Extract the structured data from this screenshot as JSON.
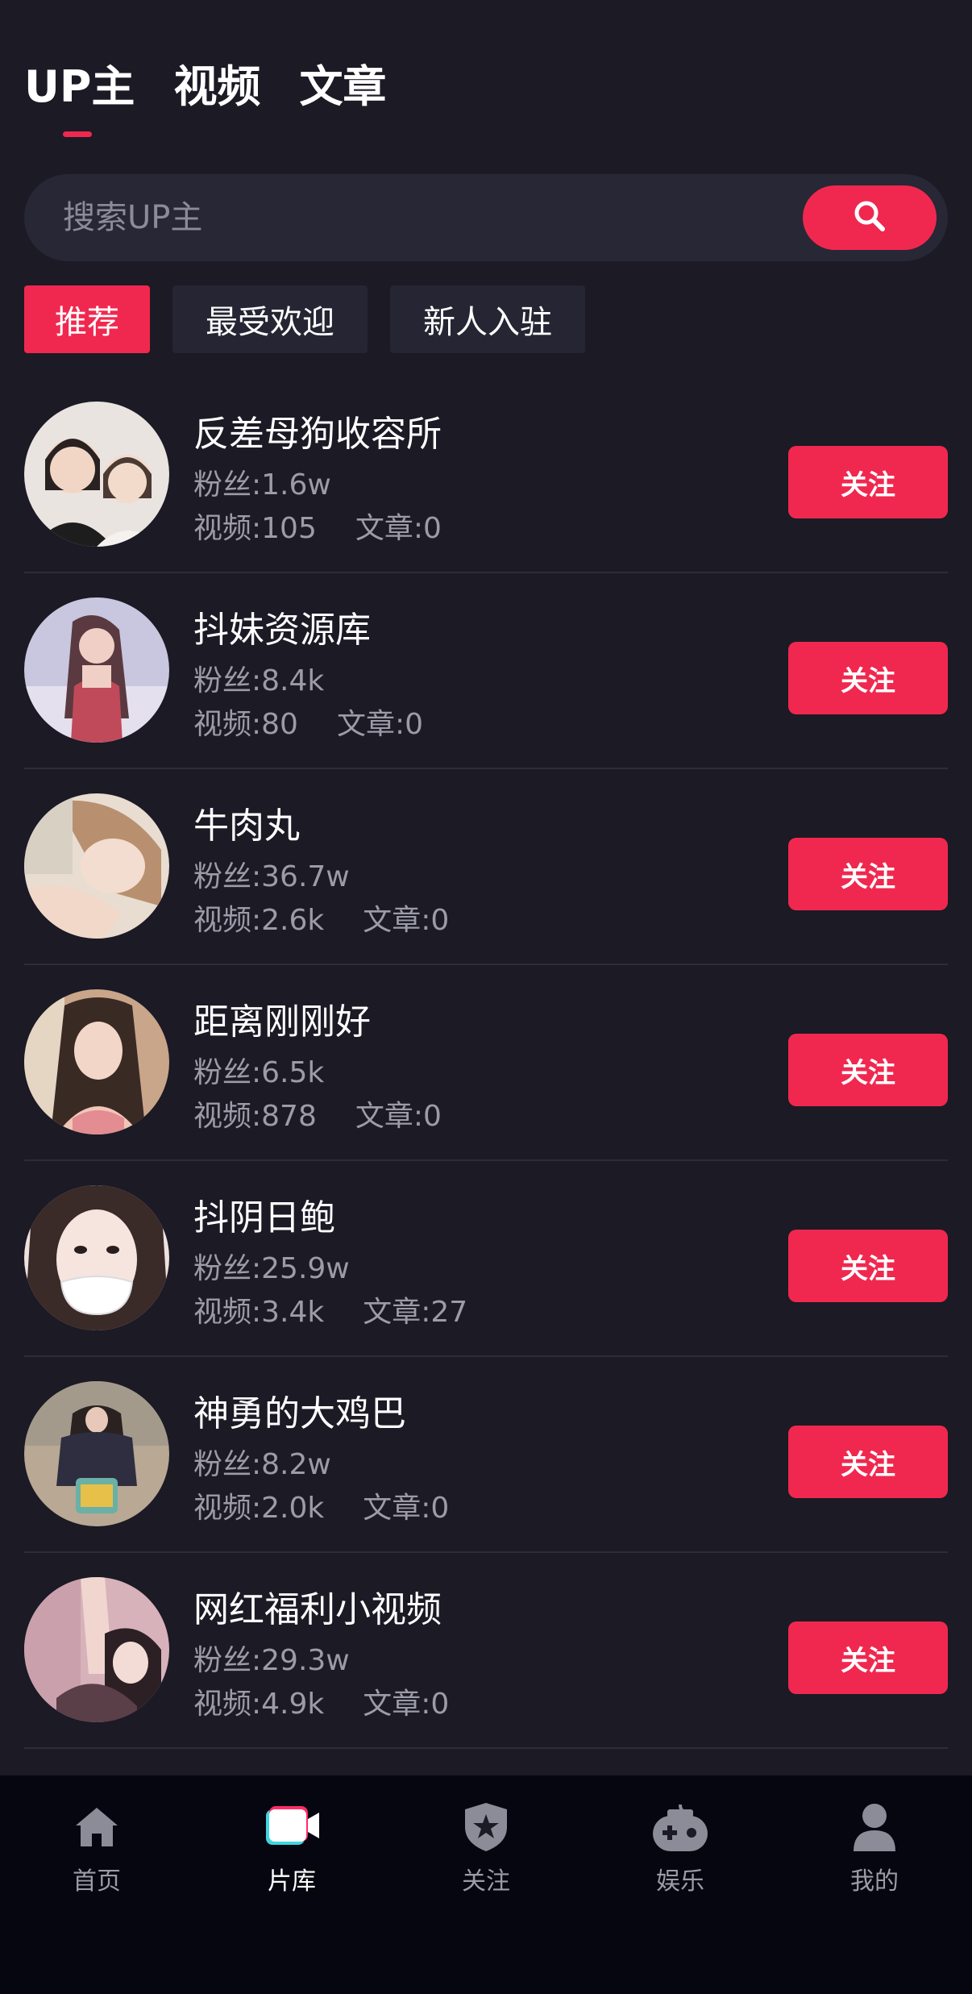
{
  "top_tabs": [
    {
      "label": "UP主",
      "active": true
    },
    {
      "label": "视频",
      "active": false
    },
    {
      "label": "文章",
      "active": false
    }
  ],
  "search": {
    "placeholder": "搜索UP主"
  },
  "filters": [
    {
      "label": "推荐",
      "active": true
    },
    {
      "label": "最受欢迎",
      "active": false
    },
    {
      "label": "新人入驻",
      "active": false
    }
  ],
  "creators": [
    {
      "name": "反差母狗收容所",
      "fans": "粉丝:1.6w",
      "videos": "视频:105",
      "articles": "文章:0",
      "follow_label": "关注",
      "avatar_colors": [
        "#e9e4e0",
        "#4a3a33"
      ]
    },
    {
      "name": "抖妹资源库",
      "fans": "粉丝:8.4k",
      "videos": "视频:80",
      "articles": "文章:0",
      "follow_label": "关注",
      "avatar_colors": [
        "#c9c6df",
        "#b5637a"
      ]
    },
    {
      "name": "牛肉丸",
      "fans": "粉丝:36.7w",
      "videos": "视频:2.6k",
      "articles": "文章:0",
      "follow_label": "关注",
      "avatar_colors": [
        "#e8ddd0",
        "#b89070"
      ]
    },
    {
      "name": "距离刚刚好",
      "fans": "粉丝:6.5k",
      "videos": "视频:878",
      "articles": "文章:0",
      "follow_label": "关注",
      "avatar_colors": [
        "#c9a58a",
        "#6a4a3a"
      ]
    },
    {
      "name": "抖阴日鲍",
      "fans": "粉丝:25.9w",
      "videos": "视频:3.4k",
      "articles": "文章:27",
      "follow_label": "关注",
      "avatar_colors": [
        "#efe2de",
        "#3a2a28"
      ]
    },
    {
      "name": "神勇的大鸡巴",
      "fans": "粉丝:8.2w",
      "videos": "视频:2.0k",
      "articles": "文章:0",
      "follow_label": "关注",
      "avatar_colors": [
        "#b8a894",
        "#2e2e40"
      ]
    },
    {
      "name": "网红福利小视频",
      "fans": "粉丝:29.3w",
      "videos": "视频:4.9k",
      "articles": "文章:0",
      "follow_label": "关注",
      "avatar_colors": [
        "#d7b2bb",
        "#5a3e48"
      ]
    }
  ],
  "bottom_nav": [
    {
      "label": "首页",
      "icon": "home-icon",
      "active": false
    },
    {
      "label": "片库",
      "icon": "video-camera-icon",
      "active": true
    },
    {
      "label": "关注",
      "icon": "shield-star-icon",
      "active": false
    },
    {
      "label": "娱乐",
      "icon": "gamepad-icon",
      "active": false
    },
    {
      "label": "我的",
      "icon": "user-icon",
      "active": false
    }
  ],
  "colors": {
    "accent": "#f0284f",
    "background": "#1b1a25",
    "nav_background": "#05060f"
  }
}
